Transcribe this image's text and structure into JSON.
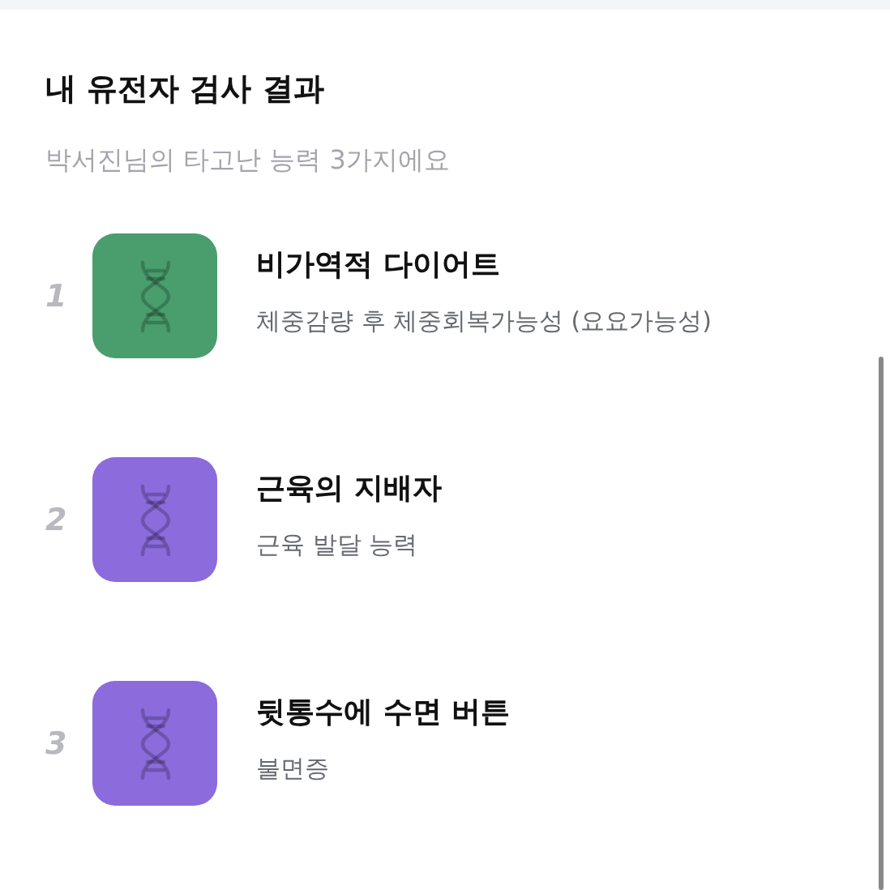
{
  "title": "내 유전자 검사 결과",
  "subtitle": "박서진님의 타고난 능력 3가지에요",
  "items": [
    {
      "rank": "1",
      "color": "#4a9e6e",
      "title": "비가역적 다이어트",
      "description": "체중감량 후 체중회복가능성 (요요가능성)"
    },
    {
      "rank": "2",
      "color": "#8c6bdc",
      "title": "근육의 지배자",
      "description": "근육 발달 능력"
    },
    {
      "rank": "3",
      "color": "#8c6bdc",
      "title": "뒷통수에 수면 버튼",
      "description": "불면증"
    }
  ]
}
